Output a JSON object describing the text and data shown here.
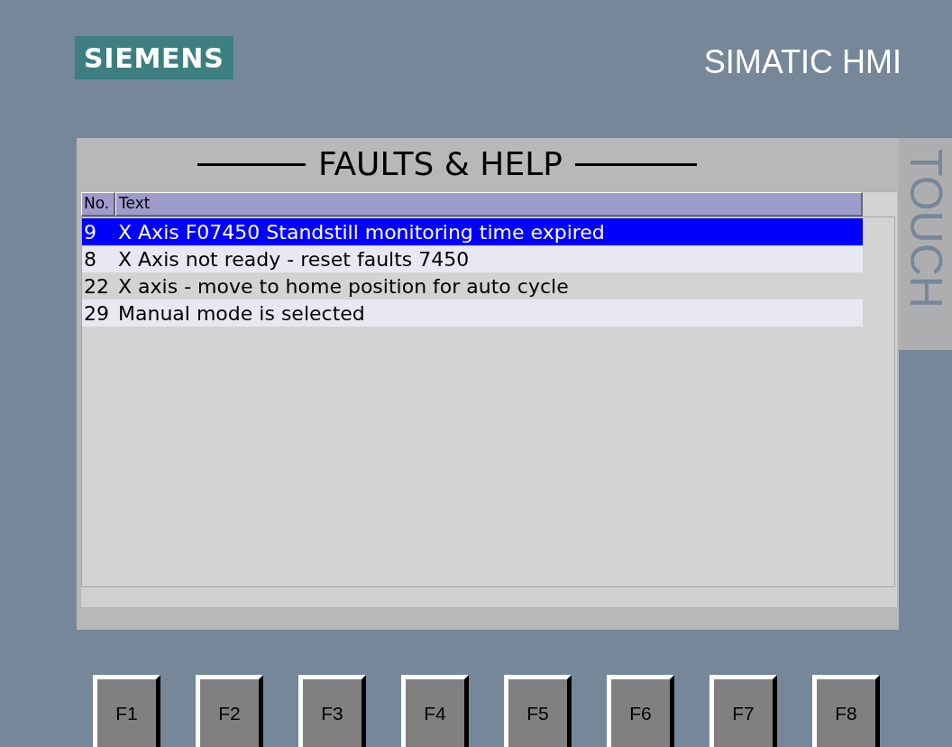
{
  "brand": {
    "logo": "SIEMENS",
    "product": "SIMATIC HMI",
    "side_label": "TOUCH"
  },
  "screen": {
    "title": "FAULTS & HELP",
    "table": {
      "columns": [
        "No.",
        "Text"
      ],
      "rows": [
        {
          "no": "9",
          "text": "X Axis F07450 Standstill monitoring time expired",
          "selected": true
        },
        {
          "no": "8",
          "text": "X Axis not ready - reset faults 7450",
          "selected": false
        },
        {
          "no": "22",
          "text": "X axis - move to home position for auto cycle",
          "selected": false
        },
        {
          "no": "29",
          "text": "Manual mode is selected",
          "selected": false
        }
      ]
    }
  },
  "function_keys": [
    "F1",
    "F2",
    "F3",
    "F4",
    "F5",
    "F6",
    "F7",
    "F8"
  ]
}
